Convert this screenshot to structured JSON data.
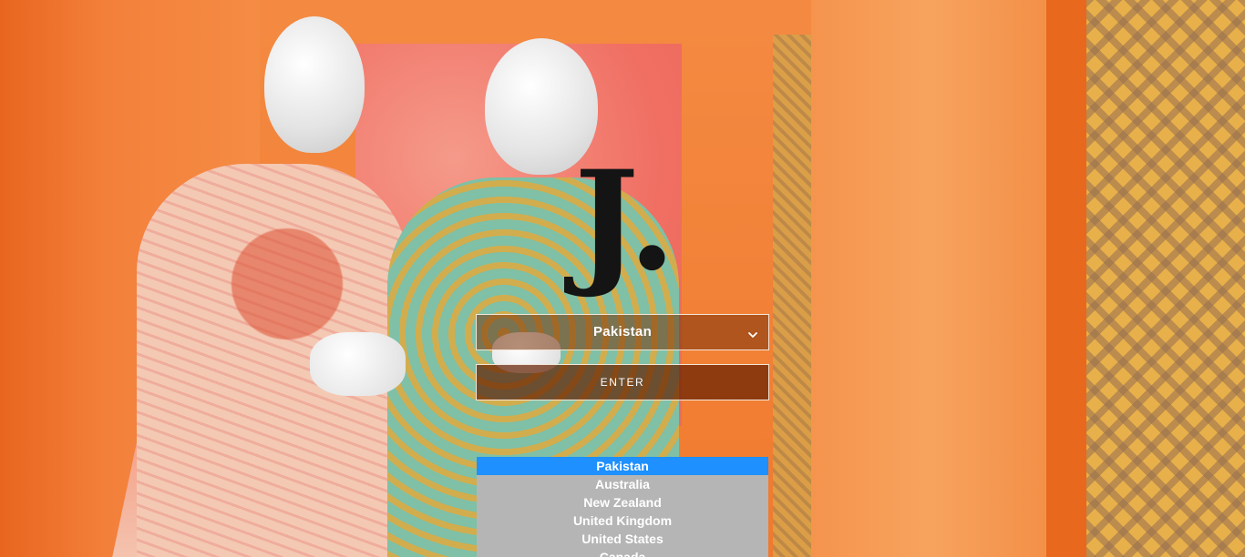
{
  "brand": {
    "logo_text": "J."
  },
  "country_selector": {
    "selected_value": "Pakistan",
    "chevron_icon": "chevron-down-icon",
    "options": [
      "Pakistan",
      "Australia",
      "New Zealand",
      "United Kingdom",
      "United States",
      "Canada"
    ],
    "highlight_color": "#1e90ff",
    "list_background": "#b5b5b5"
  },
  "enter_button": {
    "label": "ENTER"
  }
}
